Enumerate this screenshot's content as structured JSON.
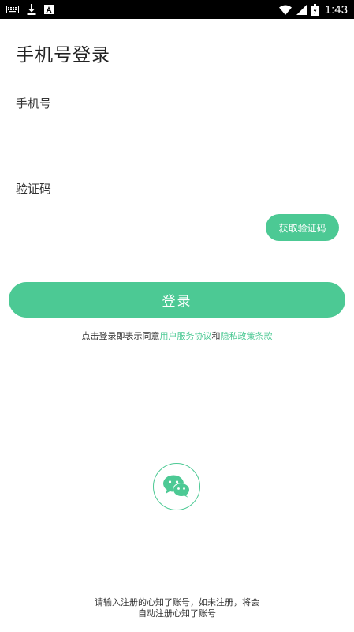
{
  "status_bar": {
    "time": "1:43",
    "left_icons": [
      "keyboard-icon",
      "download-icon",
      "font-icon"
    ],
    "right_icons": [
      "wifi-icon",
      "signal-icon",
      "battery-icon"
    ]
  },
  "page": {
    "title": "手机号登录"
  },
  "phone": {
    "label": "手机号",
    "value": "",
    "placeholder": ""
  },
  "code": {
    "label": "验证码",
    "value": "",
    "placeholder": "",
    "get_code_label": "获取验证码"
  },
  "login": {
    "label": "登录"
  },
  "agreement": {
    "prefix": "点击登录即表示同意",
    "user_agreement": "用户服务协议",
    "and": "和",
    "privacy_policy": "隐私政策条款"
  },
  "wechat": {
    "icon": "wechat-icon"
  },
  "footer": {
    "line1": "请输入注册的心知了账号，如未注册，将会",
    "line2": "自动注册心知了账号"
  },
  "colors": {
    "accent": "#4cc994",
    "status_bar_bg": "#000000",
    "divider": "#dddddd"
  }
}
